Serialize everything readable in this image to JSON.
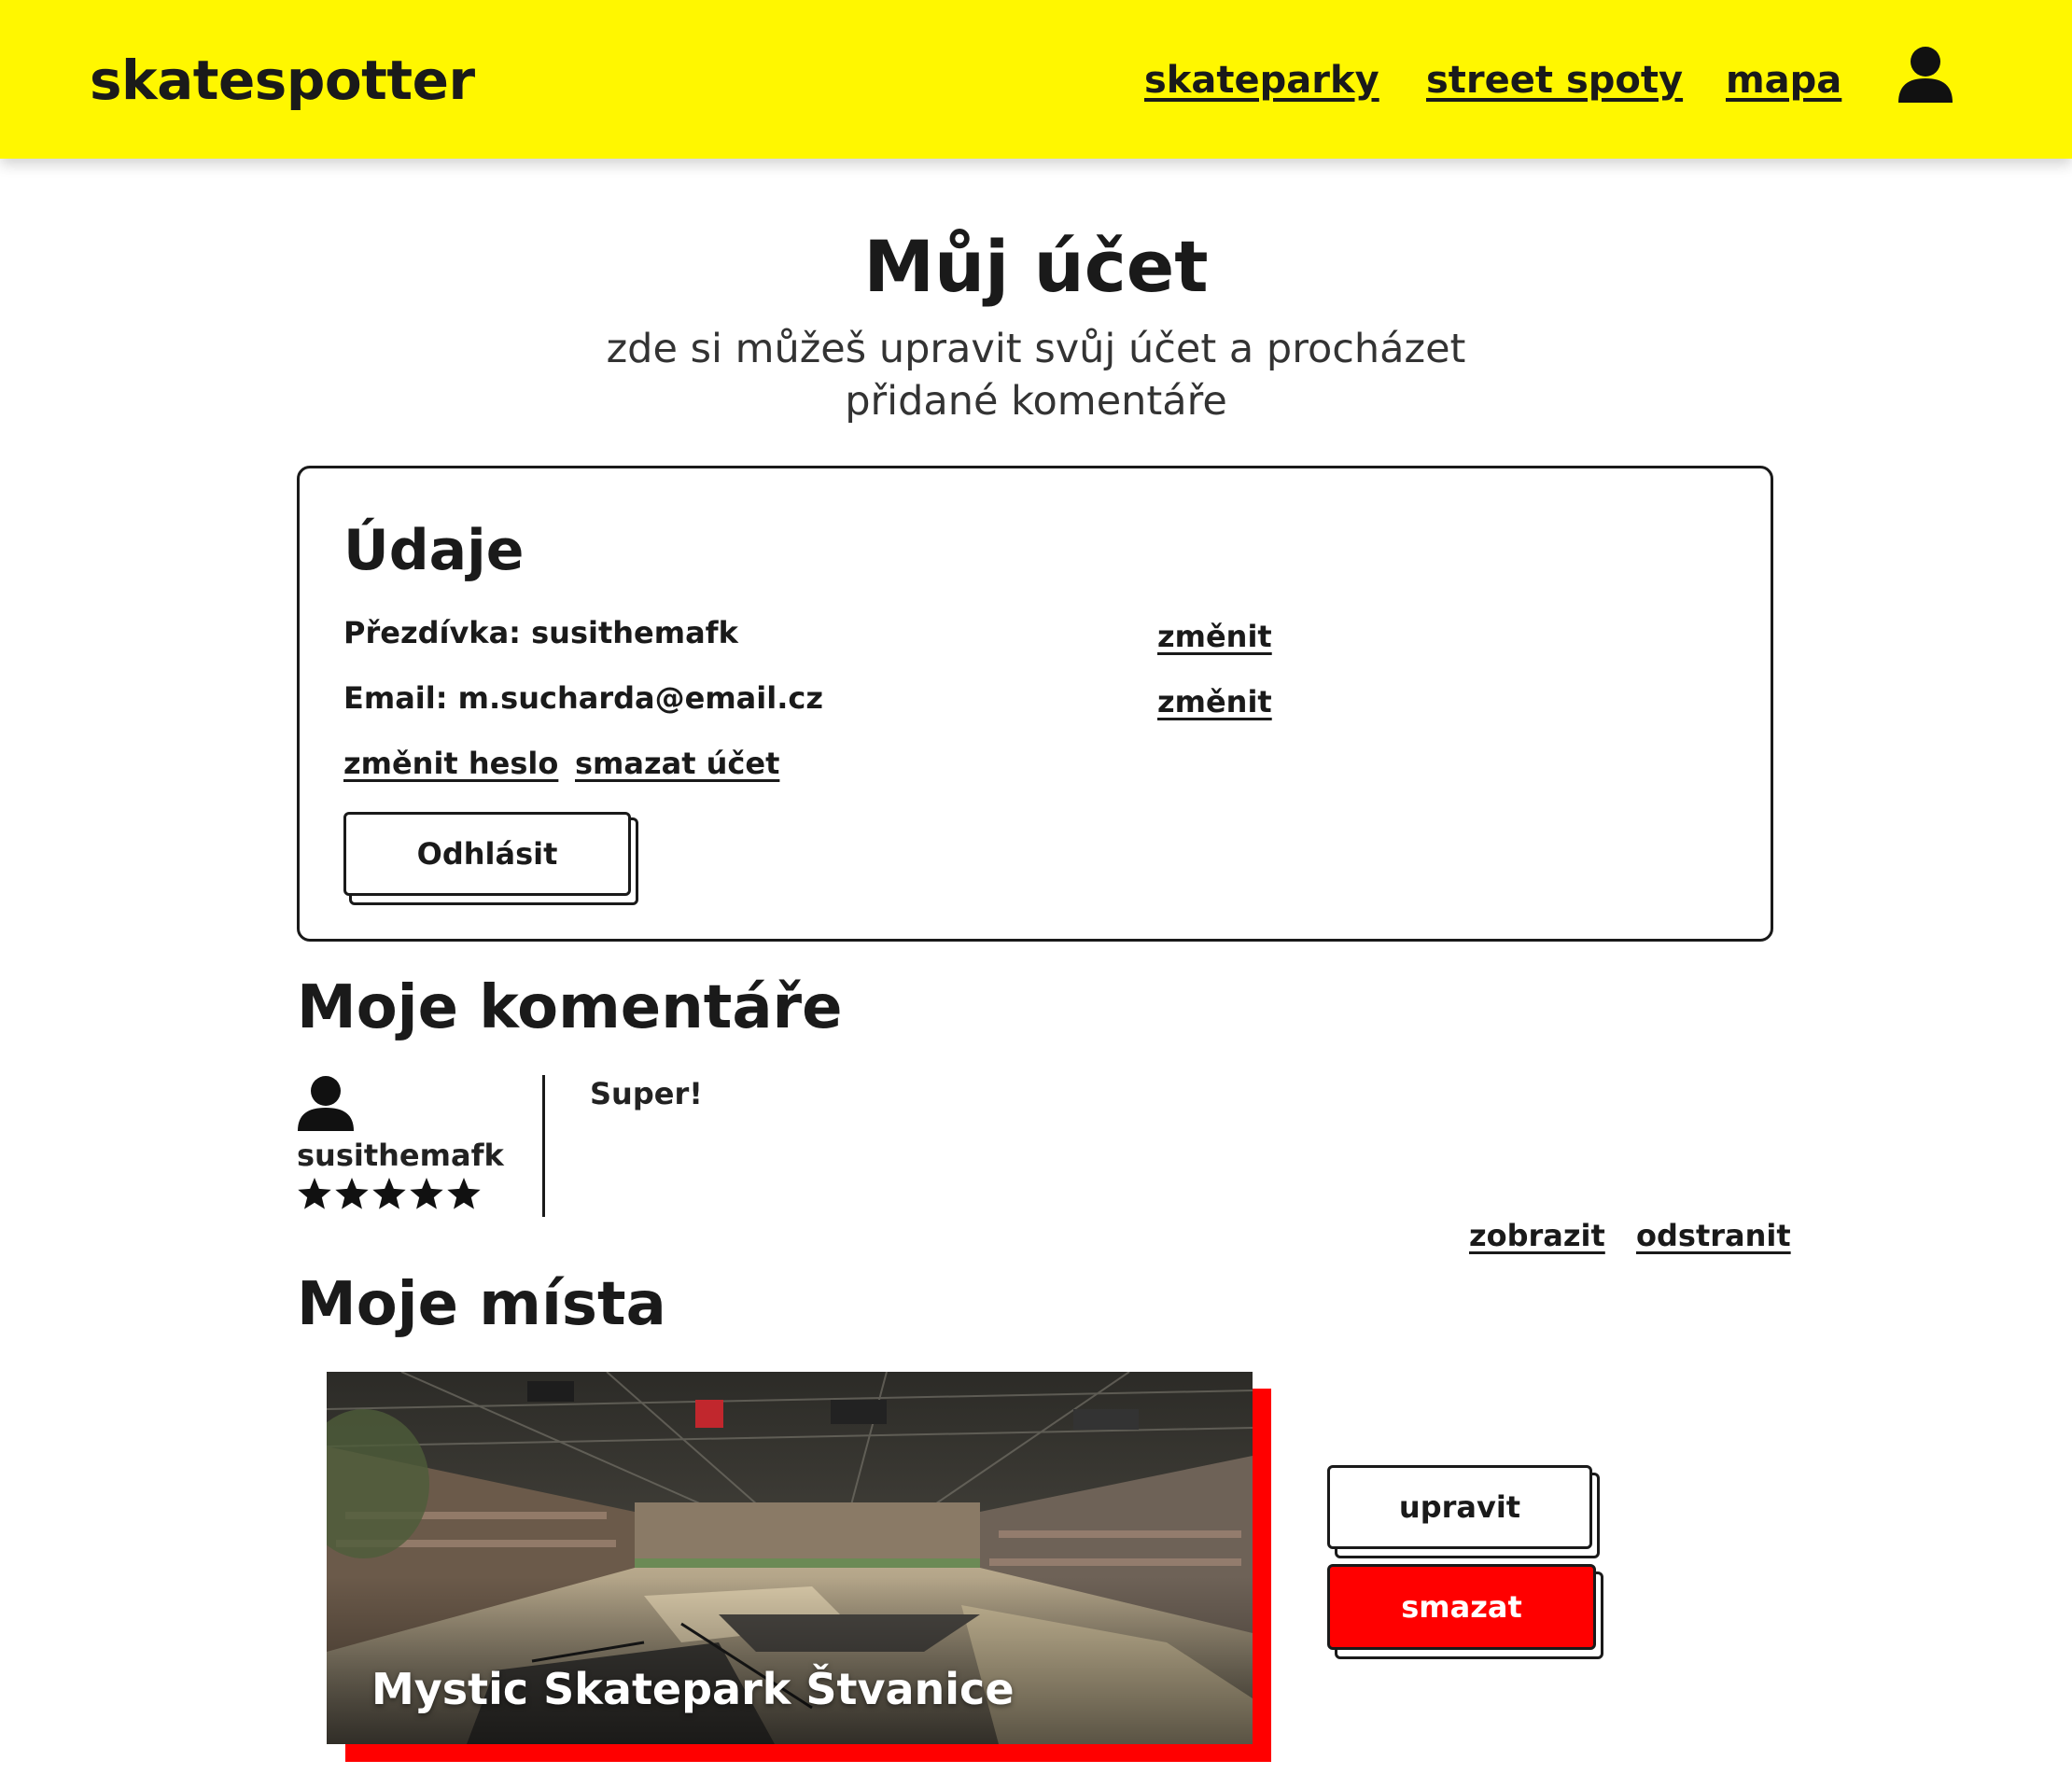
{
  "header": {
    "logo": "skatespotter",
    "nav": [
      "skateparky",
      "street spoty",
      "mapa"
    ],
    "user_icon": "user-icon"
  },
  "page": {
    "title": "Můj účet",
    "subtitle_line1": "zde si můžeš upravit svůj účet a procházet",
    "subtitle_line2": "přidané komentáře"
  },
  "details": {
    "title": "Údaje",
    "nickname_line": "Přezdívka: susithemafk",
    "email_line": "Email: m.sucharda@email.cz",
    "change_label": "změnit",
    "change_password": "změnit heslo",
    "delete_account": "smazat účet",
    "logout": "Odhlásit"
  },
  "comments": {
    "title": "Moje komentáře",
    "items": [
      {
        "user": "susithemafk",
        "rating": 5,
        "text": "Super!",
        "show_label": "zobrazit",
        "remove_label": "odstranit"
      }
    ]
  },
  "places": {
    "title": "Moje místa",
    "items": [
      {
        "name": "Mystic Skatepark Štvanice",
        "edit_label": "upravit",
        "delete_label": "smazat"
      }
    ]
  },
  "colors": {
    "header_bg": "#fff700",
    "accent_red": "#ff0000",
    "text": "#1a1a1a"
  }
}
